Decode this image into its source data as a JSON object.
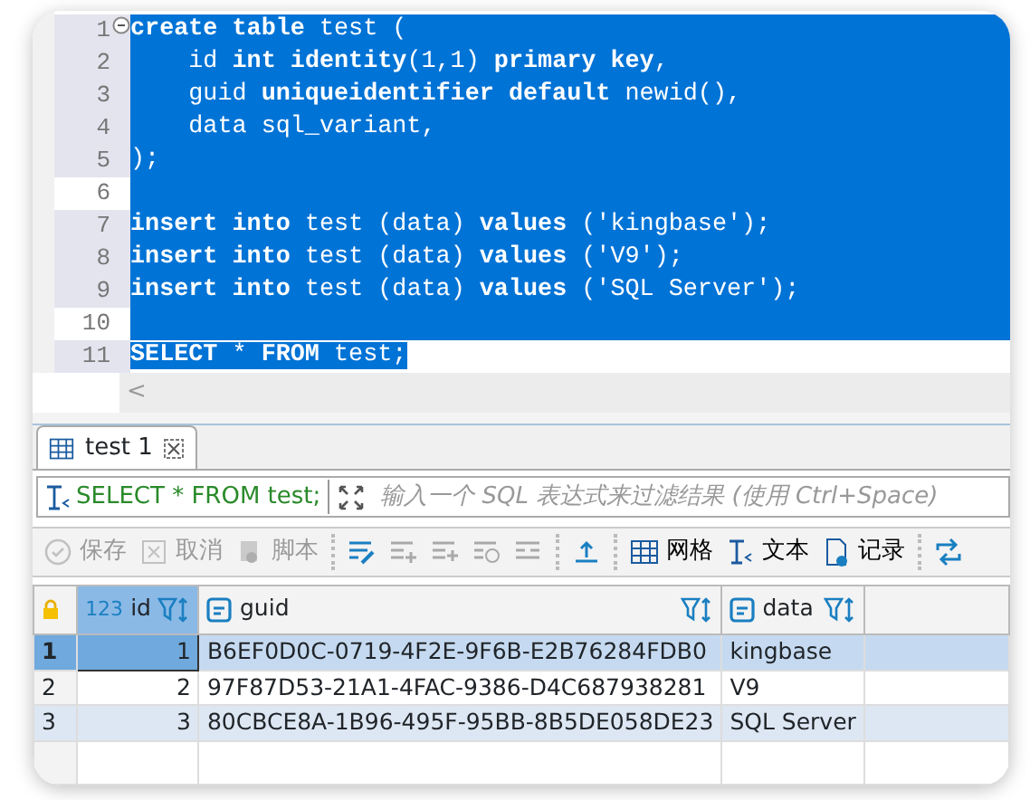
{
  "editor": {
    "lines": [
      {
        "number": "1",
        "text": "**create** **table** test (",
        "selected": true,
        "fold": true
      },
      {
        "number": "2",
        "text": "    id **int** **identity**(1,1) **primary** **key**,",
        "selected": true
      },
      {
        "number": "3",
        "text": "    guid **uniqueidentifier** **default** newid(),",
        "selected": true
      },
      {
        "number": "4",
        "text": "    data sql_variant,",
        "selected": true
      },
      {
        "number": "5",
        "text": ");",
        "selected": true
      },
      {
        "number": "6",
        "selected": true
      },
      {
        "number": "7",
        "text": "**insert** **into** test (data) **values** ('kingbase');",
        "selected": true
      },
      {
        "number": "8",
        "text": "**insert** **into** test (data) **values** ('V9');",
        "selected": true
      },
      {
        "number": "9",
        "text": "**insert** **into** test (data) **values** ('SQL Server');",
        "selected": true
      },
      {
        "number": "10",
        "selected": true
      },
      {
        "number": "11",
        "text": "**SELECT** * **FROM** test;",
        "selected": true
      }
    ],
    "scroll_arrow": "<"
  },
  "results_tabs": [
    {
      "label": "test 1",
      "selected": true
    }
  ],
  "filter": {
    "query": "SELECT * FROM test;",
    "placeholder": "输入一个 SQL 表达式来过滤结果 (使用 Ctrl+Space)"
  },
  "toolbar": [
    {
      "kind": "text",
      "label": "保存",
      "disabled": true
    },
    {
      "kind": "text",
      "label": "取消",
      "disabled": true
    },
    {
      "kind": "text",
      "label": "脚本",
      "disabled": true
    },
    {
      "kind": "sep"
    },
    {
      "kind": "icon",
      "disabled": false
    },
    {
      "kind": "icon",
      "disabled": true
    },
    {
      "kind": "icon",
      "disabled": true
    },
    {
      "kind": "icon",
      "disabled": true
    },
    {
      "kind": "icon",
      "disabled": true
    },
    {
      "kind": "sep"
    },
    {
      "kind": "icon",
      "disabled": false
    },
    {
      "kind": "sep"
    },
    {
      "kind": "text",
      "label": "网格",
      "disabled": false
    },
    {
      "kind": "text",
      "label": "文本",
      "disabled": false
    },
    {
      "kind": "text",
      "label": "记录",
      "disabled": false
    },
    {
      "kind": "sep"
    },
    {
      "kind": "icon",
      "disabled": false
    }
  ],
  "table": {
    "columns": [
      {
        "type_badge": "123",
        "name": "id",
        "kind": "number"
      },
      {
        "name": "guid",
        "kind": "string"
      },
      {
        "name": "data",
        "kind": "string"
      }
    ],
    "rows": [
      {
        "number": "1",
        "selected": true,
        "cells": [
          "1",
          "B6EF0D0C-0719-4F2E-9F6B-E2B76284FDB0",
          "kingbase"
        ]
      },
      {
        "number": "2",
        "selected": false,
        "cells": [
          "2",
          "97F87D53-21A1-4FAC-9386-D4C687938281",
          "V9"
        ]
      },
      {
        "number": "3",
        "selected": false,
        "cells": [
          "3",
          "80CBCE8A-1B96-495F-95BB-8B5DE058DE23",
          "SQL Server"
        ]
      }
    ]
  }
}
